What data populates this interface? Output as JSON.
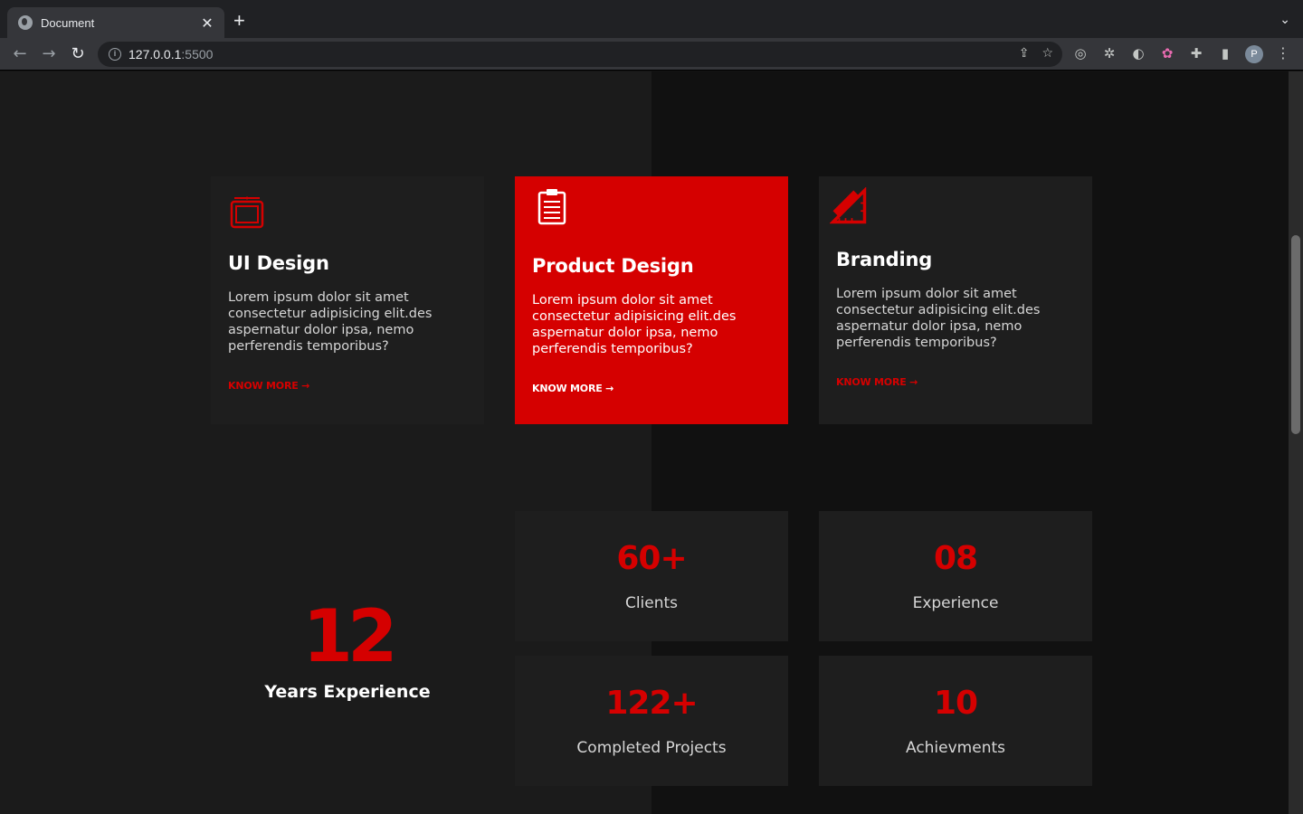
{
  "browser": {
    "tab_title": "Document",
    "tab_close": "✕",
    "new_tab": "+",
    "tab_menu": "⌄",
    "url_host": "127.0.0.1",
    "url_port": ":5500",
    "nav_back": "←",
    "nav_forward": "→",
    "nav_reload": "↻",
    "info_glyph": "i",
    "share_glyph": "⇪",
    "bookmark_glyph": "☆",
    "avatar_letter": "P",
    "menu_glyph": "⋮",
    "extensions": [
      "◎",
      "✲",
      "◐",
      "✿",
      "✚",
      "▮"
    ]
  },
  "services": [
    {
      "title": "UI Design",
      "text": "Lorem ipsum dolor sit amet consectetur adipisicing elit.des aspernatur dolor ipsa, nemo perferendis temporibus?",
      "more": "KNOW MORE →",
      "icon": "tablet-icon"
    },
    {
      "title": "Product Design",
      "text": "Lorem ipsum dolor sit amet consectetur adipisicing elit.des aspernatur dolor ipsa, nemo perferendis temporibus?",
      "more": "KNOW MORE →",
      "icon": "clipboard-icon"
    },
    {
      "title": "Branding",
      "text": "Lorem ipsum dolor sit amet consectetur adipisicing elit.des aspernatur dolor ipsa, nemo perferendis temporibus?",
      "more": "KNOW MORE →",
      "icon": "ruler-triangle-icon"
    }
  ],
  "experience": {
    "number": "12",
    "label": "Years Experience"
  },
  "stats": [
    {
      "value": "60+",
      "label": "Clients"
    },
    {
      "value": "08",
      "label": "Experience"
    },
    {
      "value": "122+",
      "label": "Completed Projects"
    },
    {
      "value": "10",
      "label": "Achievments"
    }
  ],
  "colors": {
    "accent": "#d50000",
    "background": "#1b1b1b",
    "card": "#1e1e1e"
  }
}
